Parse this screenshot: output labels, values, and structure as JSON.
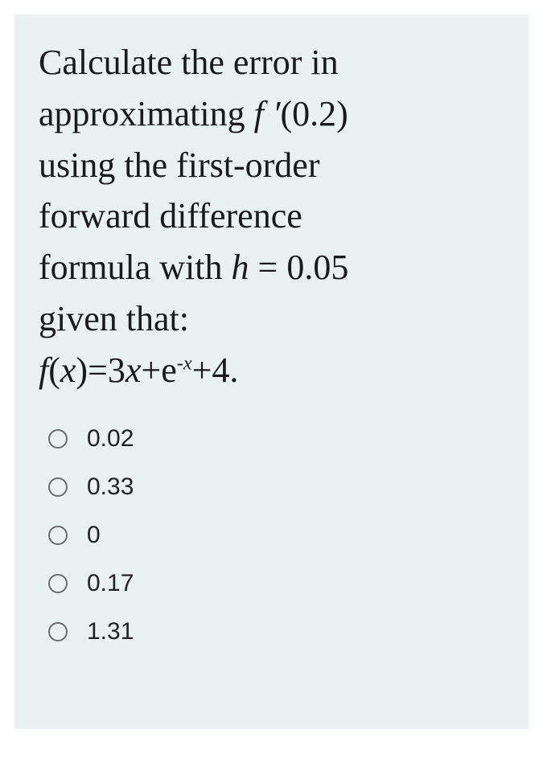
{
  "question": {
    "line1": "Calculate the error in",
    "line2_prefix": "approximating ",
    "line2_fprime": "f ′",
    "line2_arg": "(0.2)",
    "line3": "using the first-order",
    "line4": "forward difference",
    "line5_prefix": "formula with ",
    "line5_h": "h",
    "line5_eq": " = 0.05",
    "line6": "given that:",
    "eq_f": "f",
    "eq_open": "(",
    "eq_x1": "x",
    "eq_close_eq": ")=3",
    "eq_x2": "x",
    "eq_plus_e": "+e",
    "eq_exp": "-x",
    "eq_tail": "+4."
  },
  "options": [
    {
      "label": "0.02"
    },
    {
      "label": "0.33"
    },
    {
      "label": "0"
    },
    {
      "label": "0.17"
    },
    {
      "label": "1.31"
    }
  ]
}
